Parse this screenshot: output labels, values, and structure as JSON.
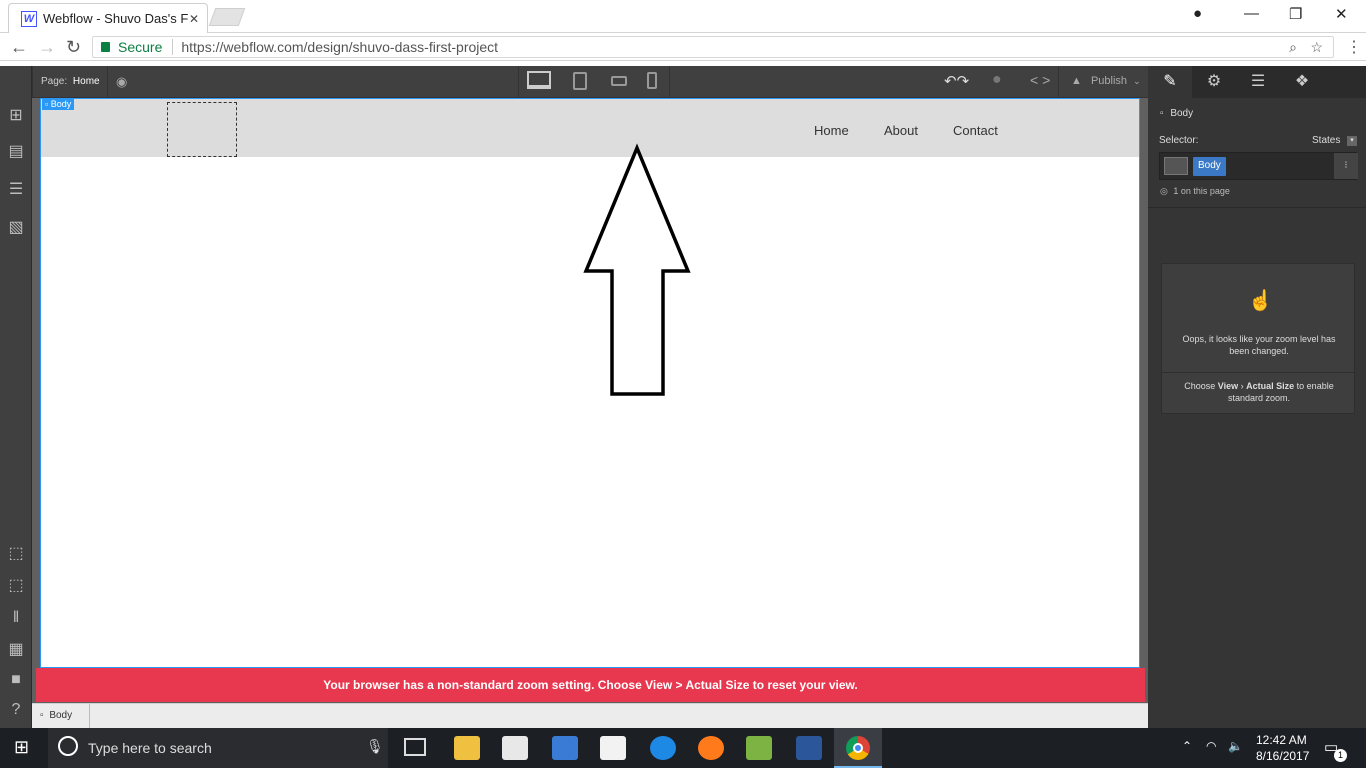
{
  "browser": {
    "tab_title": "Webflow - Shuvo Das's F",
    "tab_favicon": "W",
    "security_label": "Secure",
    "url": "https://webflow.com/design/shuvo-dass-first-project"
  },
  "designer": {
    "logo": "W",
    "page_label": "Page:",
    "page_name": "Home",
    "publish_label": "Publish",
    "selected_tag": "Body",
    "breadcrumb": "Body"
  },
  "canvas": {
    "nav_links": [
      "Home",
      "About",
      "Contact"
    ],
    "warning": "Your browser has a non-standard zoom setting. Choose View > Actual Size to reset your view."
  },
  "style_panel": {
    "element_label": "Body",
    "selector_label": "Selector:",
    "states_label": "States",
    "selector_chip": "Body",
    "usage": "1 on this page",
    "zoom_msg_1": "Oops, it looks like your zoom level has been changed.",
    "zoom_msg_2_pre": "Choose ",
    "zoom_msg_2_view": "View",
    "zoom_msg_2_sep": " › ",
    "zoom_msg_2_actual": "Actual Size",
    "zoom_msg_2_post": " to enable standard zoom."
  },
  "taskbar": {
    "search_placeholder": "Type here to search",
    "time": "12:42 AM",
    "date": "8/16/2017",
    "notif_count": "1"
  },
  "colors": {
    "accent": "#2b98f5",
    "warning": "#e8384f",
    "secure": "#0b8043"
  }
}
